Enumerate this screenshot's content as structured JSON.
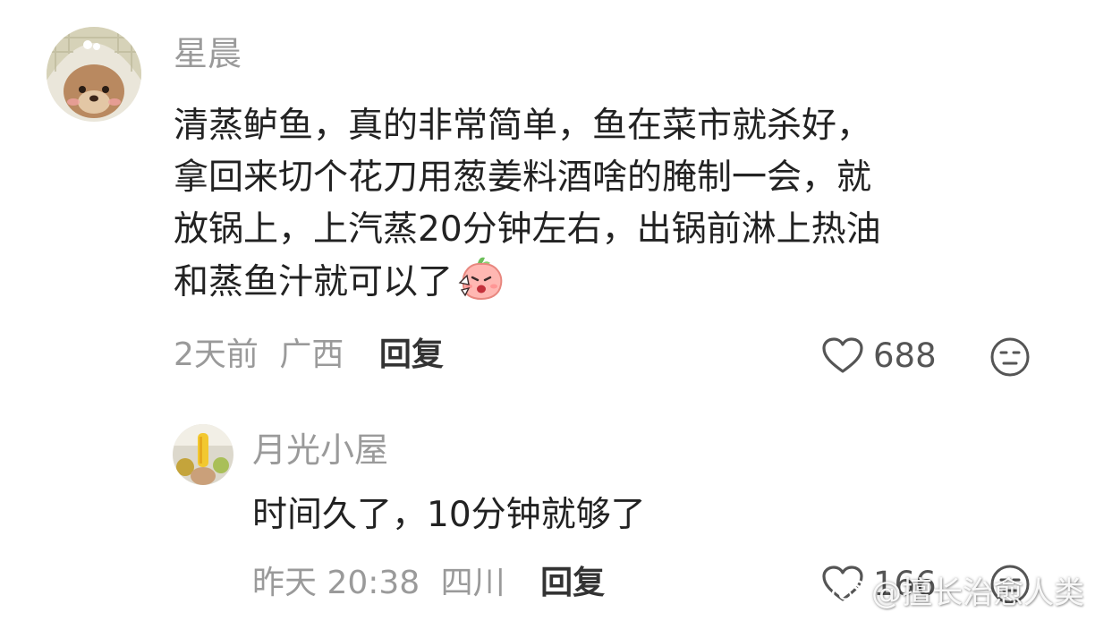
{
  "comments": [
    {
      "username": "星晨",
      "lines": [
        "清蒸鲈鱼，真的非常简单，鱼在菜市就杀好，",
        "拿回来切个花刀用葱姜料酒啥的腌制一会，就",
        "放锅上，上汽蒸20分钟左右，出锅前淋上热油",
        "和蒸鱼汁就可以了"
      ],
      "time": "2天前",
      "location": "广西",
      "reply_label": "回复",
      "likes": "688",
      "avatar_icon": "teddy-bear-avatar",
      "emoji_icon": "peach-angry-emoji"
    },
    {
      "username": "月光小屋",
      "text": "时间久了，10分钟就够了",
      "time": "昨天 20:38",
      "location": "四川",
      "reply_label": "回复",
      "likes": "166",
      "avatar_icon": "photo-avatar"
    }
  ],
  "watermark": {
    "text": "@擅长治愈人类",
    "icon": "weibo-icon"
  },
  "colors": {
    "username": "#9a9a9a",
    "body_text": "#222222",
    "meta": "#9a9a9a",
    "reply": "#333333",
    "like_icon": "#555555"
  }
}
